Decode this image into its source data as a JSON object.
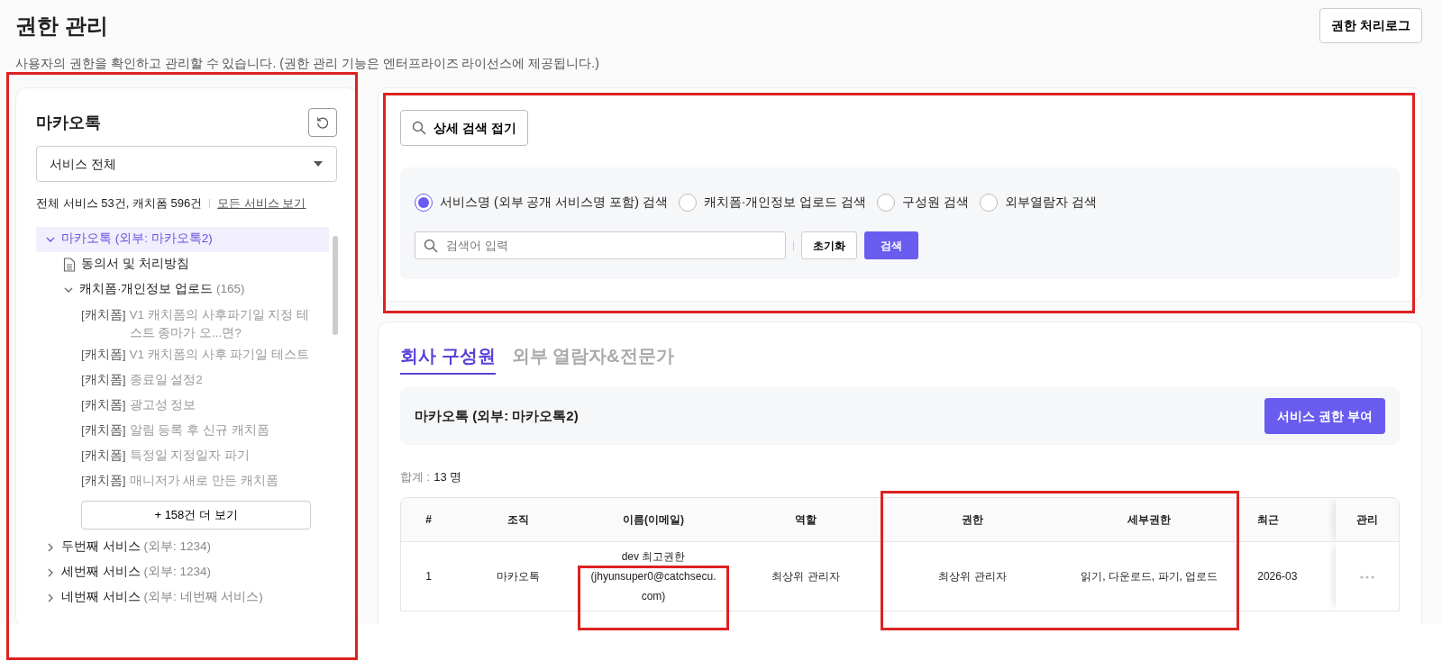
{
  "page": {
    "title": "권한 관리",
    "description": "사용자의 권한을 확인하고 관리할 수 있습니다. (권한 관리 기능은 엔터프라이즈 라이선스에 제공됩니다.)"
  },
  "log_button": "권한 처리로그",
  "sidebar": {
    "highlighted": true,
    "title": "마카오톡",
    "filter": {
      "value": "서비스 전체"
    },
    "summary": "전체 서비스 53건, 캐치폼 596건",
    "all_link": "모든 서비스 보기",
    "tree": [
      {
        "kind": "service",
        "label": "마카오톡",
        "sub": "(외부: 마카오톡2)",
        "expanded": true,
        "selected": true,
        "children": [
          {
            "kind": "doc",
            "label": "동의서 및 처리방침"
          },
          {
            "kind": "group",
            "label": "캐치폼·개인정보 업로드",
            "count": "(165)",
            "expanded": true,
            "more_button": "+ 158건 더 보기",
            "children": [
              {
                "kind": "form",
                "tag": "[캐치폼]",
                "label": "V1 캐치폼의 사후파기일 지정 테스트 종마가 오...면?"
              },
              {
                "kind": "form",
                "tag": "[캐치폼]",
                "label": "V1 캐치폼의 사후 파기일 테스트"
              },
              {
                "kind": "form",
                "tag": "[캐치폼]",
                "label": "종료일 설정2"
              },
              {
                "kind": "form",
                "tag": "[캐치폼]",
                "label": "광고성 정보"
              },
              {
                "kind": "form",
                "tag": "[캐치폼]",
                "label": "알림 등록 후 신규 캐치폼"
              },
              {
                "kind": "form",
                "tag": "[캐치폼]",
                "label": "특정일 지정일자 파기"
              },
              {
                "kind": "form",
                "tag": "[캐치폼]",
                "label": "매니저가 새로 만든 캐치폼"
              }
            ]
          }
        ]
      },
      {
        "kind": "service",
        "label": "두번째 서비스",
        "sub": "(외부: 1234)",
        "expanded": false,
        "selected": false
      },
      {
        "kind": "service",
        "label": "세번째 서비스",
        "sub": "(외부: 1234)",
        "expanded": false,
        "selected": false
      },
      {
        "kind": "service",
        "label": "네번째 서비스",
        "sub": "(외부: 네번째 서비스)",
        "expanded": false,
        "selected": false
      }
    ]
  },
  "search_panel": {
    "highlighted": true,
    "toggle_button": "상세 검색 접기",
    "options": [
      {
        "label": "서비스명 (외부 공개 서비스명 포함) 검색",
        "selected": true
      },
      {
        "label": "캐치폼·개인정보 업로드 검색",
        "selected": false
      },
      {
        "label": "구성원 검색",
        "selected": false
      },
      {
        "label": "외부열람자 검색",
        "selected": false
      }
    ],
    "input": {
      "placeholder": "검색어 입력"
    },
    "reset_button": "초기화",
    "search_button": "검색"
  },
  "members": {
    "tabs": [
      {
        "label": "회사 구성원",
        "selected": true
      },
      {
        "label": "외부 열람자&전문가",
        "selected": false
      }
    ],
    "service_name": "마카오톡 (외부: 마카오톡2)",
    "grant_button": "서비스 권한 부여",
    "total_label": "합계 :",
    "total_value": "13 명",
    "table": {
      "columns": [
        {
          "label": "#"
        },
        {
          "label": "조직"
        },
        {
          "label": "이름(이메일)"
        },
        {
          "label": "역할"
        },
        {
          "label": "권한",
          "highlighted": true
        },
        {
          "label": "세부권한",
          "highlighted": true
        },
        {
          "label": "최근"
        },
        {
          "label": "관리"
        }
      ],
      "rows": [
        {
          "cells": [
            {
              "text": "1"
            },
            {
              "text": "마카오톡"
            },
            {
              "text": "dev 최고권한 (jhyunsuper0@catchsecu.com)",
              "highlighted": true
            },
            {
              "text": "최상위 관리자"
            },
            {
              "text": "최상위 관리자"
            },
            {
              "text": "읽기, 다운로드, 파기, 업로드"
            },
            {
              "text": "2026-03"
            }
          ]
        }
      ]
    }
  }
}
